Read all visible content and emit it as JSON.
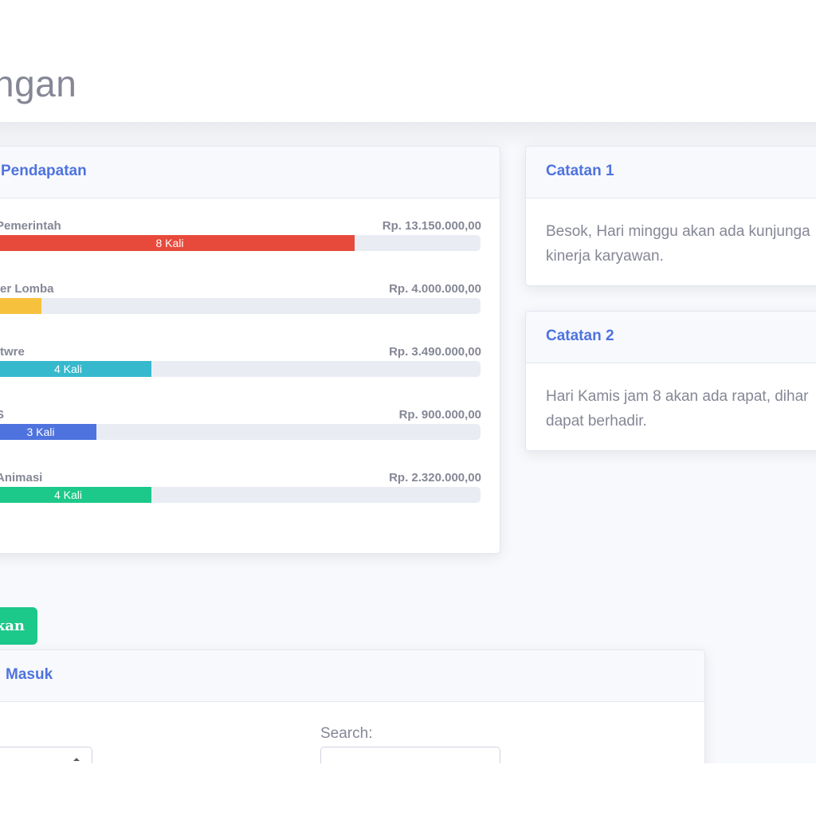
{
  "header": {
    "title": "ngan"
  },
  "pendapatan": {
    "title": "Pendapatan",
    "items": [
      {
        "label": "Pemerintah",
        "amount": "Rp. 13.150.000,00",
        "bar_text": "8 Kali",
        "color": "#e74a3b",
        "percent": 74.6
      },
      {
        "label": "ter Lomba",
        "amount": "Rp. 4.000.000,00",
        "bar_text": "",
        "color": "#f6c23e",
        "percent": 11.4
      },
      {
        "label": "ftwre",
        "amount": "Rp. 3.490.000,00",
        "bar_text": "4 Kali",
        "color": "#36b9cc",
        "percent": 33.6
      },
      {
        "label": "S",
        "amount": "Rp. 900.000,00",
        "bar_text": "3 Kali",
        "color": "#4e73df",
        "percent": 22.5
      },
      {
        "label": "Animasi",
        "amount": "Rp. 2.320.000,00",
        "bar_text": "4 Kali",
        "color": "#1cc88a",
        "percent": 33.6
      }
    ]
  },
  "notes": [
    {
      "title": "Catatan 1",
      "line1": "Besok, Hari minggu akan ada kunjunga",
      "line2": "kinerja karyawan."
    },
    {
      "title": "Catatan 2",
      "line1": "Hari Kamis jam 8 akan ada rapat, dihar",
      "line2": "dapat berhadir."
    }
  ],
  "action_button": {
    "label": "kan"
  },
  "masuk": {
    "title": "Masuk",
    "search_label": "Search:"
  }
}
